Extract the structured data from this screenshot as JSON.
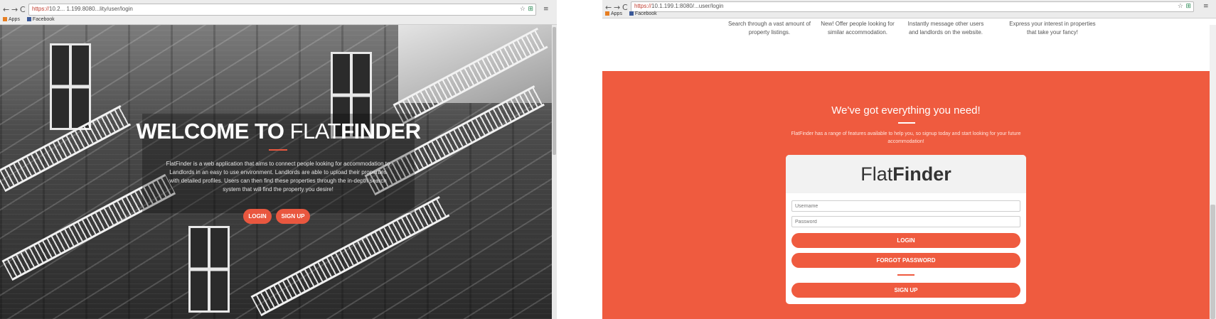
{
  "left_browser": {
    "nav": {
      "back": "←",
      "forward": "→",
      "reload": "C"
    },
    "url": {
      "scheme": "https://",
      "rest": "10.2... 1.199.8080...lity/user/login"
    },
    "icons": {
      "star": "☆",
      "ext": "⊞",
      "menu": "≡"
    },
    "bookmarks": [
      {
        "label": "Apps"
      },
      {
        "label": "Facebook"
      }
    ]
  },
  "left_page": {
    "title_bold": "WELCOME TO",
    "title_light": "FLAT",
    "title_bold2": "FINDER",
    "description": "FlatFinder is a web application that aims to connect people looking for accommodation to Landlords in an easy to use environment. Landlords are able to upload their properties with detailed profiles. Users can then find these properties through the in-depth search system that will find the property you desire!",
    "login_label": "LOGIN",
    "signup_label": "SIGN UP"
  },
  "right_browser": {
    "nav": {
      "back": "←",
      "forward": "→",
      "reload": "C"
    },
    "url": {
      "scheme": "https://",
      "rest": "10.1.199.1:8080/...user/login"
    },
    "icons": {
      "star": "☆",
      "ext": "⊞",
      "menu": "≡"
    },
    "bookmarks": [
      {
        "label": "Apps"
      },
      {
        "label": "Facebook"
      }
    ]
  },
  "right_page": {
    "features": [
      "Search through a vast amount of property listings.",
      "New! Offer people looking for similar accommodation.",
      "Instantly message other users and landlords on the website.",
      "Express your interest in properties that take your fancy!"
    ],
    "heading": "We've got everything you need!",
    "subtext": "FlatFinder has a range of features available to help you, so signup today and start looking for your future accommodation!",
    "brand_light": "Flat",
    "brand_bold": "Finder",
    "username_placeholder": "Username",
    "password_placeholder": "Password",
    "login_label": "LOGIN",
    "forgot_label": "FORGOT PASSWORD",
    "signup_label": "SIGN UP"
  },
  "colors": {
    "accent": "#ef5b3f",
    "hero_accent": "#e9573f"
  }
}
